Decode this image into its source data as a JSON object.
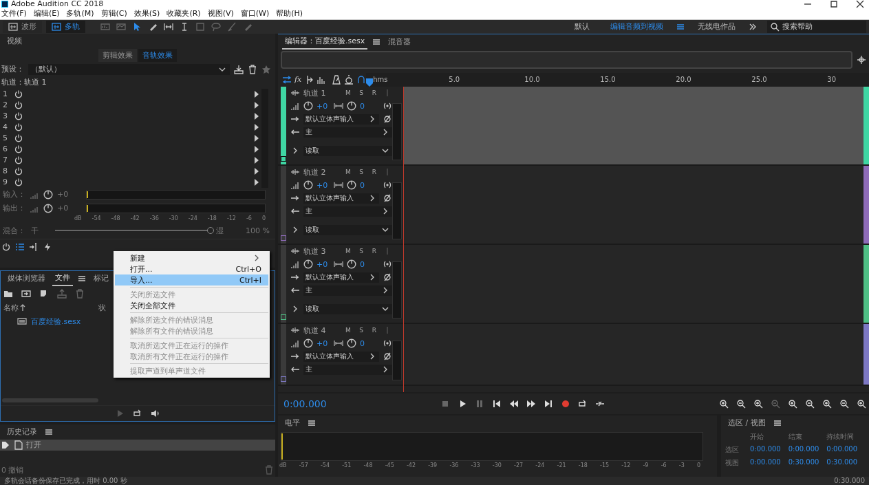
{
  "title_bar": {
    "title": "Adobe Audition CC 2018"
  },
  "menu_bar": [
    "文件(F)",
    "编辑(E)",
    "多轨(M)",
    "剪辑(C)",
    "效果(S)",
    "收藏夹(R)",
    "视图(V)",
    "窗口(W)",
    "帮助(H)"
  ],
  "toolbar": {
    "modes": [
      {
        "label": "波形",
        "selected": false
      },
      {
        "label": "多轨",
        "selected": true
      }
    ],
    "workspaces": [
      {
        "label": "默认",
        "selected": false
      },
      {
        "label": "编辑音频到视频",
        "selected": true
      },
      {
        "label": "无线电作品",
        "selected": false
      }
    ],
    "search": {
      "placeholder": "搜索帮助"
    }
  },
  "effects_rack": {
    "panel_tab": "视频",
    "tabs": [
      {
        "label": "剪辑效果",
        "selected": false
      },
      {
        "label": "音轨效果",
        "selected": true
      }
    ],
    "preset_label": "预设：",
    "preset_value": "（默认）",
    "track_label": "轨道：轨道 1",
    "slots": [
      "1",
      "2",
      "3",
      "4",
      "5",
      "6",
      "7",
      "8",
      "9"
    ],
    "input": {
      "label": "输入：",
      "gain": "+0"
    },
    "output": {
      "label": "输出：",
      "gain": "+0"
    },
    "scale": [
      "dB",
      "-54",
      "-48",
      "-42",
      "-36",
      "-30",
      "-24",
      "-18",
      "-12",
      "-6",
      "0"
    ],
    "mix": {
      "label": "混合：",
      "dry": "干",
      "wet": "湿",
      "level": 1,
      "reading": "100 %"
    }
  },
  "files_panel": {
    "tabs": [
      {
        "label": "媒体浏览器",
        "selected": false
      },
      {
        "label": "文件",
        "selected": true
      },
      {
        "label": "标记",
        "selected": false
      }
    ],
    "columns": [
      "名称",
      "状"
    ],
    "files": [
      "百度经验.sesx"
    ]
  },
  "history": {
    "title": "历史记录",
    "entries": [
      {
        "label": "打开",
        "selected": true
      }
    ],
    "undo_count": "0 撤销"
  },
  "editor": {
    "tabs": [
      {
        "label": "编辑器：百度经验.sesx",
        "selected": true
      },
      {
        "label": "混音器",
        "selected": false
      }
    ],
    "effects_label": "fx",
    "ruler": [
      "hms",
      "5.0",
      "10.0",
      "15.0",
      "20.0",
      "25.0",
      "30"
    ],
    "tracks": [
      {
        "name": "轨道 1",
        "selected": true,
        "color": "#3fd6a3",
        "controls": [
          "M",
          "S",
          "R"
        ],
        "volume": "+0",
        "pan": "0",
        "input": "默认立体声输入",
        "output": "主",
        "automation": "读取"
      },
      {
        "name": "轨道 2",
        "selected": false,
        "color": "#8e6bb8",
        "controls": [
          "M",
          "S",
          "R"
        ],
        "volume": "+0",
        "pan": "0",
        "input": "默认立体声输入",
        "output": "主",
        "automation": "读取"
      },
      {
        "name": "轨道 3",
        "selected": false,
        "color": "#4fbf85",
        "controls": [
          "M",
          "S",
          "R"
        ],
        "volume": "+0",
        "pan": "0",
        "input": "默认立体声输入",
        "output": "主",
        "automation": "读取"
      },
      {
        "name": "轨道 4",
        "selected": false,
        "color": "#7d78c4",
        "controls": [
          "M",
          "S",
          "R"
        ],
        "volume": "+0",
        "pan": "0",
        "input": "默认立体声输入",
        "output": "主"
      }
    ]
  },
  "transport": {
    "time": "0:00.000"
  },
  "levels": {
    "title": "电平",
    "scale": [
      "dB",
      "-57",
      "-54",
      "-51",
      "-48",
      "-45",
      "-42",
      "-39",
      "-36",
      "-33",
      "-30",
      "-27",
      "-24",
      "-21",
      "-18",
      "-15",
      "-12",
      "-9",
      "-6",
      "-3",
      "0"
    ]
  },
  "selection_view": {
    "title": "选区 / 视图",
    "columns": [
      "开始",
      "结束",
      "持续时间"
    ],
    "rows": [
      {
        "label": "选区",
        "values": [
          "0:00.000",
          "0:00.000",
          "0:00.000"
        ]
      },
      {
        "label": "视图",
        "values": [
          "0:00.000",
          "0:30.000",
          "0:30.000"
        ]
      }
    ]
  },
  "context_menu": {
    "groups": [
      [
        {
          "label": "新建",
          "submenu": true,
          "disabled": false,
          "selected": false
        },
        {
          "label": "打开...",
          "shortcut": "Ctrl+O",
          "submenu": false,
          "disabled": false,
          "selected": false
        },
        {
          "label": "导入...",
          "shortcut": "Ctrl+I",
          "submenu": false,
          "disabled": false,
          "selected": true
        }
      ],
      [
        {
          "label": "关闭所选文件",
          "submenu": false,
          "disabled": true,
          "selected": false
        },
        {
          "label": "关闭全部文件",
          "submenu": false,
          "disabled": false,
          "selected": false
        }
      ],
      [
        {
          "label": "解除所选文件的错误消息",
          "submenu": false,
          "disabled": true,
          "selected": false
        },
        {
          "label": "解除所有文件的错误消息",
          "submenu": false,
          "disabled": true,
          "selected": false
        }
      ],
      [
        {
          "label": "取消所选文件正在运行的操作",
          "submenu": false,
          "disabled": true,
          "selected": false
        },
        {
          "label": "取消所有文件正在运行的操作",
          "submenu": false,
          "disabled": true,
          "selected": false
        }
      ],
      [
        {
          "label": "提取声道到单声道文件",
          "submenu": false,
          "disabled": true,
          "selected": false
        }
      ]
    ]
  },
  "status_bar": {
    "message": "多轨会话备份保存已完成，用时 0.00 秒",
    "duration": "0:30.000"
  }
}
